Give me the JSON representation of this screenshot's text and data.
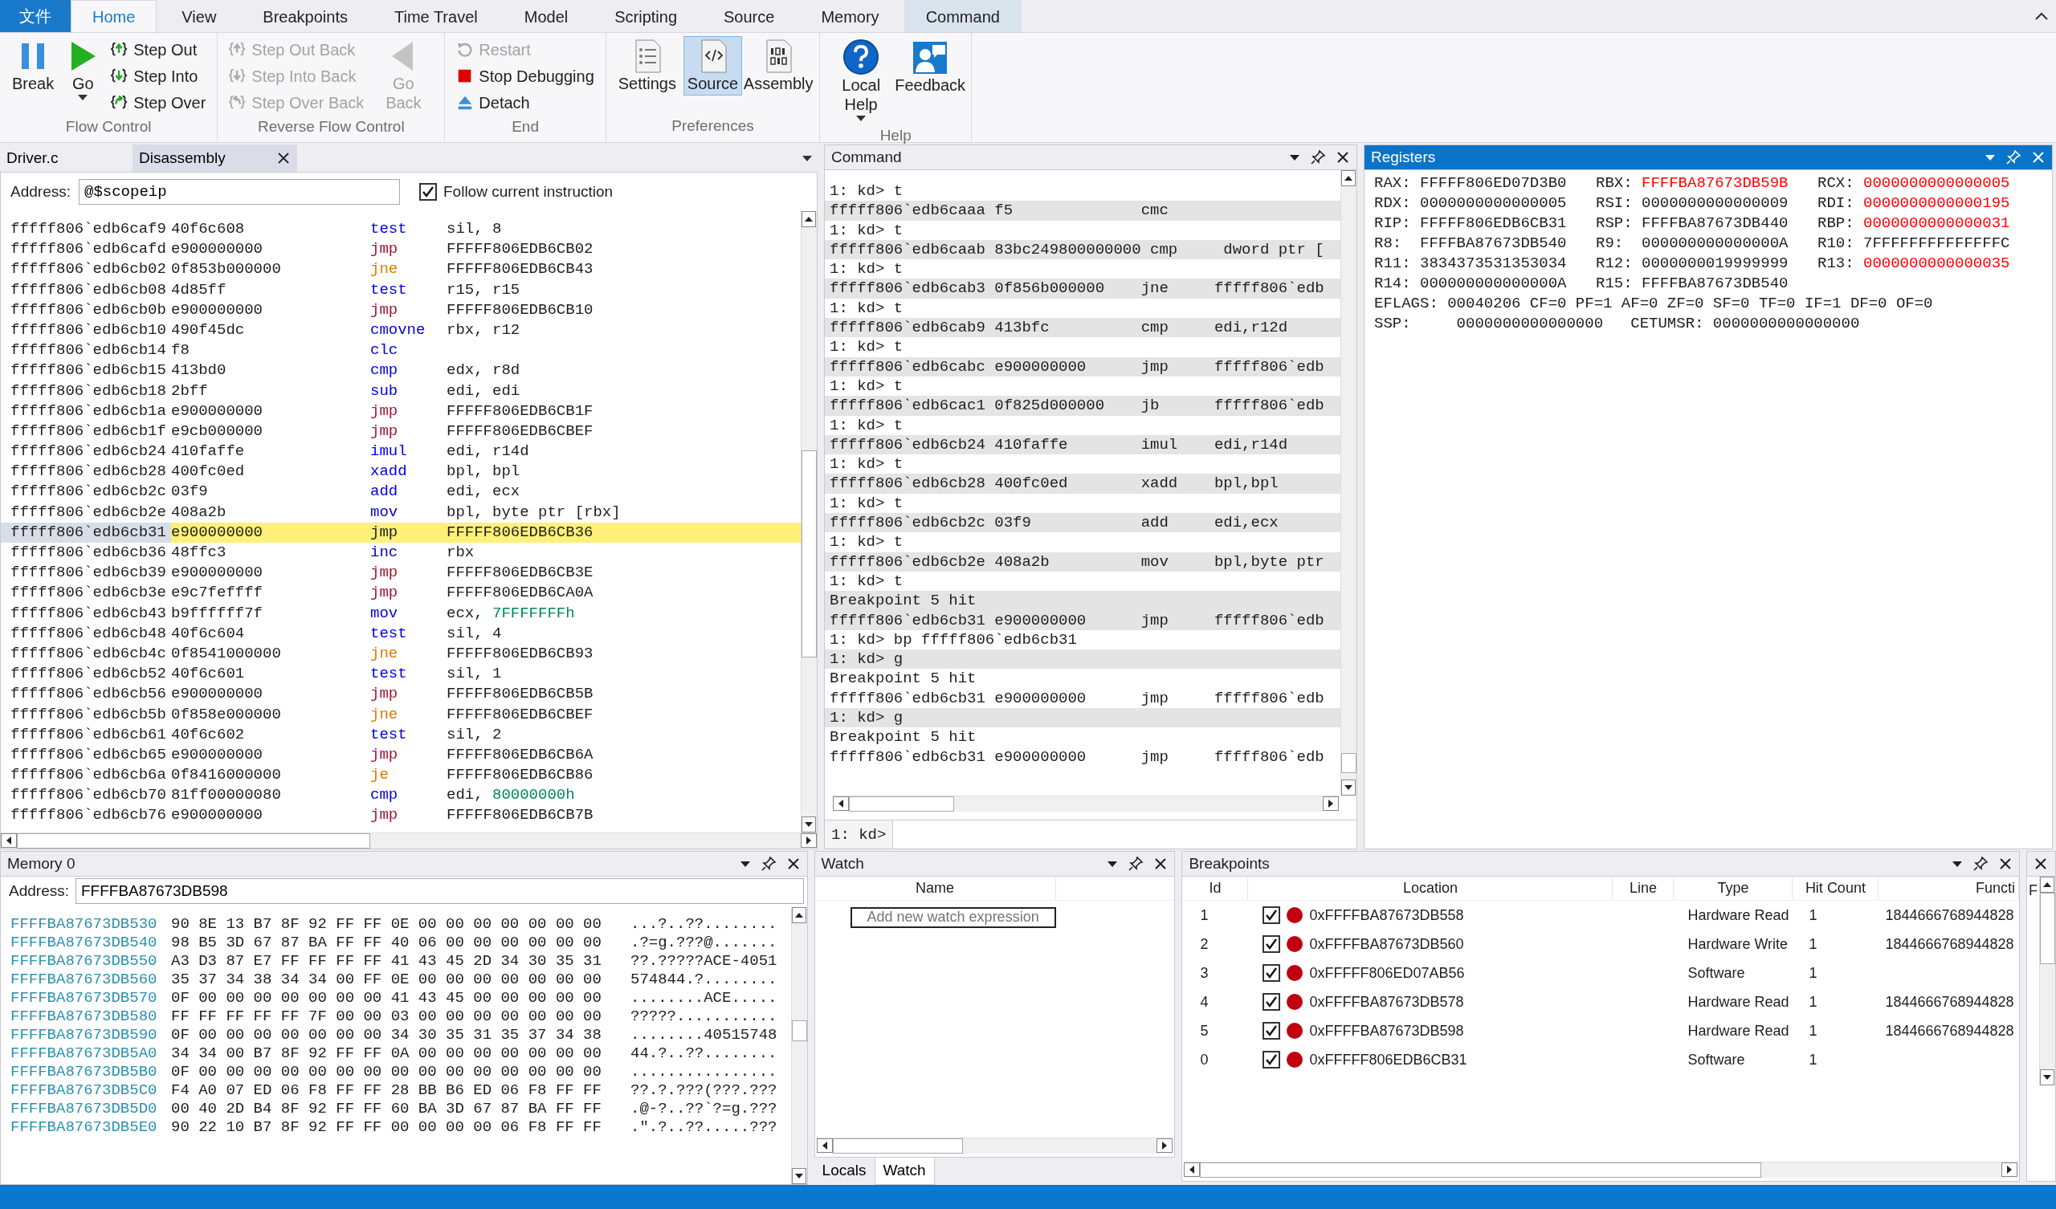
{
  "ribbon": {
    "file_tab": "文件",
    "tabs": [
      {
        "label": "Home",
        "selected": true,
        "highlighted": false
      },
      {
        "label": "View",
        "selected": false,
        "highlighted": false
      },
      {
        "label": "Breakpoints",
        "selected": false,
        "highlighted": false
      },
      {
        "label": "Time Travel",
        "selected": false,
        "highlighted": false
      },
      {
        "label": "Model",
        "selected": false,
        "highlighted": false
      },
      {
        "label": "Scripting",
        "selected": false,
        "highlighted": false
      },
      {
        "label": "Source",
        "selected": false,
        "highlighted": false
      },
      {
        "label": "Memory",
        "selected": false,
        "highlighted": false
      },
      {
        "label": "Command",
        "selected": false,
        "highlighted": true
      }
    ],
    "groups": [
      {
        "label": "Flow Control",
        "items": [
          {
            "label": "Break",
            "kind": "large",
            "disabled": false,
            "selected": false,
            "dropdown": false
          },
          {
            "label": "Go",
            "kind": "large",
            "disabled": false,
            "selected": false,
            "dropdown": true
          },
          {
            "label": "Step Out",
            "kind": "small",
            "disabled": false
          },
          {
            "label": "Step Into",
            "kind": "small",
            "disabled": false
          },
          {
            "label": "Step Over",
            "kind": "small",
            "disabled": false
          }
        ]
      },
      {
        "label": "Reverse Flow Control",
        "items": [
          {
            "label": "Step Out Back",
            "kind": "small",
            "disabled": true
          },
          {
            "label": "Step Into Back",
            "kind": "small",
            "disabled": true
          },
          {
            "label": "Step Over Back",
            "kind": "small",
            "disabled": true
          },
          {
            "label": "Go Back",
            "kind": "large",
            "disabled": true,
            "selected": false,
            "dropdown": false
          }
        ]
      },
      {
        "label": "End",
        "items": [
          {
            "label": "Restart",
            "kind": "small",
            "disabled": true
          },
          {
            "label": "Stop Debugging",
            "kind": "small",
            "disabled": false
          },
          {
            "label": "Detach",
            "kind": "small",
            "disabled": false
          }
        ]
      },
      {
        "label": "Preferences",
        "items": [
          {
            "label": "Settings",
            "kind": "large",
            "disabled": false,
            "selected": false,
            "dropdown": false
          },
          {
            "label": "Source",
            "kind": "large",
            "disabled": false,
            "selected": true,
            "dropdown": false
          },
          {
            "label": "Assembly",
            "kind": "large",
            "disabled": false,
            "selected": false,
            "dropdown": false
          }
        ]
      },
      {
        "label": "Help",
        "items": [
          {
            "label": "Local Help",
            "kind": "large",
            "disabled": false,
            "selected": false,
            "dropdown": true
          },
          {
            "label": "Feedback",
            "kind": "large",
            "disabled": false,
            "selected": false,
            "dropdown": false
          }
        ]
      }
    ]
  },
  "disassembly_pane": {
    "tabs": [
      {
        "label": "Driver.c",
        "selected": false
      },
      {
        "label": "Disassembly",
        "selected": true
      }
    ],
    "address_label": "Address:",
    "address": "@$scopeip",
    "follow": {
      "label": "Follow current instruction",
      "checked": true
    },
    "rows": [
      {
        "address": "fffff806`edb6caf9",
        "bytes": "40f6c608",
        "mnemonic": "test",
        "operands": "sil, 8",
        "color": "#0000e0",
        "current": false
      },
      {
        "address": "fffff806`edb6cafd",
        "bytes": "e900000000",
        "mnemonic": "jmp",
        "operands": "FFFFF806EDB6CB02",
        "color": "#a01530",
        "current": false
      },
      {
        "address": "fffff806`edb6cb02",
        "bytes": "0f853b000000",
        "mnemonic": "jne",
        "operands": "FFFFF806EDB6CB43",
        "color": "#e07800",
        "current": false
      },
      {
        "address": "fffff806`edb6cb08",
        "bytes": "4d85ff",
        "mnemonic": "test",
        "operands": "r15, r15",
        "color": "#0000e0",
        "current": false
      },
      {
        "address": "fffff806`edb6cb0b",
        "bytes": "e900000000",
        "mnemonic": "jmp",
        "operands": "FFFFF806EDB6CB10",
        "color": "#a01530",
        "current": false
      },
      {
        "address": "fffff806`edb6cb10",
        "bytes": "490f45dc",
        "mnemonic": "cmovne",
        "operands": "rbx, r12",
        "color": "#0000e0",
        "current": false
      },
      {
        "address": "fffff806`edb6cb14",
        "bytes": "f8",
        "mnemonic": "clc",
        "color": "#0000e0",
        "current": false
      },
      {
        "address": "fffff806`edb6cb15",
        "bytes": "413bd0",
        "mnemonic": "cmp",
        "operands": "edx, r8d",
        "color": "#0000e0",
        "current": false
      },
      {
        "address": "fffff806`edb6cb18",
        "bytes": "2bff",
        "mnemonic": "sub",
        "operands": "edi, edi",
        "color": "#0000e0",
        "current": false
      },
      {
        "address": "fffff806`edb6cb1a",
        "bytes": "e900000000",
        "mnemonic": "jmp",
        "operands": "FFFFF806EDB6CB1F",
        "color": "#a01530",
        "current": false
      },
      {
        "address": "fffff806`edb6cb1f",
        "bytes": "e9cb000000",
        "mnemonic": "jmp",
        "operands": "FFFFF806EDB6CBEF",
        "color": "#a01530",
        "current": false
      },
      {
        "address": "fffff806`edb6cb24",
        "bytes": "410faffe",
        "mnemonic": "imul",
        "operands": "edi, r14d",
        "color": "#0000e0",
        "current": false
      },
      {
        "address": "fffff806`edb6cb28",
        "bytes": "400fc0ed",
        "mnemonic": "xadd",
        "operands": "bpl, bpl",
        "color": "#0000e0",
        "current": false
      },
      {
        "address": "fffff806`edb6cb2c",
        "bytes": "03f9",
        "mnemonic": "add",
        "operands": "edi, ecx",
        "color": "#0000e0",
        "current": false
      },
      {
        "address": "fffff806`edb6cb2e",
        "bytes": "408a2b",
        "mnemonic": "mov",
        "operands": "bpl, byte ptr [rbx]",
        "color": "#0000e0",
        "current": false
      },
      {
        "address": "fffff806`edb6cb31",
        "bytes": "e900000000",
        "mnemonic": "jmp",
        "operands": "FFFFF806EDB6CB36",
        "current": true
      },
      {
        "address": "fffff806`edb6cb36",
        "bytes": "48ffc3",
        "mnemonic": "inc",
        "operands": "rbx",
        "color": "#0000e0",
        "current": false
      },
      {
        "address": "fffff806`edb6cb39",
        "bytes": "e900000000",
        "mnemonic": "jmp",
        "operands": "FFFFF806EDB6CB3E",
        "color": "#a01530",
        "current": false
      },
      {
        "address": "fffff806`edb6cb3e",
        "bytes": "e9c7feffff",
        "mnemonic": "jmp",
        "operands": "FFFFF806EDB6CA0A",
        "color": "#a01530",
        "current": false
      },
      {
        "address": "fffff806`edb6cb43",
        "bytes": "b9ffffff7f",
        "mnemonic": "mov",
        "operands": "ecx,",
        "immediate": "7FFFFFFFh",
        "color": "#0000e0",
        "current": false
      },
      {
        "address": "fffff806`edb6cb48",
        "bytes": "40f6c604",
        "mnemonic": "test",
        "operands": "sil, 4",
        "color": "#0000e0",
        "current": false
      },
      {
        "address": "fffff806`edb6cb4c",
        "bytes": "0f8541000000",
        "mnemonic": "jne",
        "operands": "FFFFF806EDB6CB93",
        "color": "#e07800",
        "current": false
      },
      {
        "address": "fffff806`edb6cb52",
        "bytes": "40f6c601",
        "mnemonic": "test",
        "operands": "sil, 1",
        "color": "#0000e0",
        "current": false
      },
      {
        "address": "fffff806`edb6cb56",
        "bytes": "e900000000",
        "mnemonic": "jmp",
        "operands": "FFFFF806EDB6CB5B",
        "color": "#a01530",
        "current": false
      },
      {
        "address": "fffff806`edb6cb5b",
        "bytes": "0f858e000000",
        "mnemonic": "jne",
        "operands": "FFFFF806EDB6CBEF",
        "color": "#e07800",
        "current": false
      },
      {
        "address": "fffff806`edb6cb61",
        "bytes": "40f6c602",
        "mnemonic": "test",
        "operands": "sil, 2",
        "color": "#0000e0",
        "current": false
      },
      {
        "address": "fffff806`edb6cb65",
        "bytes": "e900000000",
        "mnemonic": "jmp",
        "operands": "FFFFF806EDB6CB6A",
        "color": "#a01530",
        "current": false
      },
      {
        "address": "fffff806`edb6cb6a",
        "bytes": "0f8416000000",
        "mnemonic": "je",
        "operands": "FFFFF806EDB6CB86",
        "color": "#e07800",
        "current": false
      },
      {
        "address": "fffff806`edb6cb70",
        "bytes": "81ff00000080",
        "mnemonic": "cmp",
        "operands": "edi,",
        "immediate": "80000000h",
        "color": "#0000e0",
        "current": false
      },
      {
        "address": "fffff806`edb6cb76",
        "bytes": "e900000000",
        "mnemonic": "jmp",
        "operands": "FFFFF806EDB6CB7B",
        "color": "#a01530",
        "current": false
      }
    ]
  },
  "command_pane": {
    "title": "Command",
    "active": false,
    "prompt": "1: kd>",
    "lines": [
      {
        "text": "1: kd> t",
        "shaded": false
      },
      {
        "text": "fffff806`edb6caaa f5              cmc",
        "shaded": true
      },
      {
        "text": "1: kd> t",
        "shaded": false
      },
      {
        "text": "fffff806`edb6caab 83bc249800000000 cmp     dword ptr [",
        "shaded": true
      },
      {
        "text": "1: kd> t",
        "shaded": false
      },
      {
        "text": "fffff806`edb6cab3 0f856b000000    jne     fffff806`edb",
        "shaded": true
      },
      {
        "text": "1: kd> t",
        "shaded": false
      },
      {
        "text": "fffff806`edb6cab9 413bfc          cmp     edi,r12d",
        "shaded": true
      },
      {
        "text": "1: kd> t",
        "shaded": false
      },
      {
        "text": "fffff806`edb6cabc e900000000      jmp     fffff806`edb",
        "shaded": true
      },
      {
        "text": "1: kd> t",
        "shaded": false
      },
      {
        "text": "fffff806`edb6cac1 0f825d000000    jb      fffff806`edb",
        "shaded": true
      },
      {
        "text": "1: kd> t",
        "shaded": false
      },
      {
        "text": "fffff806`edb6cb24 410faffe        imul    edi,r14d",
        "shaded": true
      },
      {
        "text": "1: kd> t",
        "shaded": false
      },
      {
        "text": "fffff806`edb6cb28 400fc0ed        xadd    bpl,bpl",
        "shaded": true
      },
      {
        "text": "1: kd> t",
        "shaded": false
      },
      {
        "text": "fffff806`edb6cb2c 03f9            add     edi,ecx",
        "shaded": true
      },
      {
        "text": "1: kd> t",
        "shaded": false
      },
      {
        "text": "fffff806`edb6cb2e 408a2b          mov     bpl,byte ptr",
        "shaded": true
      },
      {
        "text": "1: kd> t",
        "shaded": false
      },
      {
        "text": "Breakpoint 5 hit",
        "shaded": true
      },
      {
        "text": "fffff806`edb6cb31 e900000000      jmp     fffff806`edb",
        "shaded": true
      },
      {
        "text": "1: kd> bp fffff806`edb6cb31",
        "shaded": false
      },
      {
        "text": "1: kd> g",
        "shaded": true
      },
      {
        "text": "Breakpoint 5 hit",
        "shaded": false
      },
      {
        "text": "fffff806`edb6cb31 e900000000      jmp     fffff806`edb",
        "shaded": false
      },
      {
        "text": "1: kd> g",
        "shaded": true
      },
      {
        "text": "Breakpoint 5 hit",
        "shaded": false
      },
      {
        "text": "fffff806`edb6cb31 e900000000      jmp     fffff806`edb",
        "shaded": false
      }
    ]
  },
  "registers_pane": {
    "title": "Registers",
    "active": true,
    "registers": [
      {
        "name": "RAX:",
        "value": "FFFFF806ED07D3B0",
        "changed": false
      },
      {
        "name": "RBX:",
        "value": "FFFFBA87673DB59B",
        "changed": true
      },
      {
        "name": "RCX:",
        "value": "0000000000000005",
        "changed": true
      },
      {
        "name": "RDX:",
        "value": "0000000000000005",
        "changed": false
      },
      {
        "name": "RSI:",
        "value": "0000000000000009",
        "changed": false
      },
      {
        "name": "RDI:",
        "value": "0000000000000195",
        "changed": true
      },
      {
        "name": "RIP:",
        "value": "FFFFF806EDB6CB31",
        "changed": false
      },
      {
        "name": "RSP:",
        "value": "FFFFBA87673DB440",
        "changed": false
      },
      {
        "name": "RBP:",
        "value": "0000000000000031",
        "changed": true
      },
      {
        "name": "R8:",
        "value": "FFFFBA87673DB540",
        "changed": false
      },
      {
        "name": "R9:",
        "value": "000000000000000A",
        "changed": false
      },
      {
        "name": "R10:",
        "value": "7FFFFFFFFFFFFFFC",
        "changed": false
      },
      {
        "name": "R11:",
        "value": "3834373531353034",
        "changed": false
      },
      {
        "name": "R12:",
        "value": "0000000019999999",
        "changed": false
      },
      {
        "name": "R13:",
        "value": "0000000000000035",
        "changed": true
      },
      {
        "name": "R14:",
        "value": "000000000000000A",
        "changed": false
      },
      {
        "name": "R15:",
        "value": "FFFFBA87673DB540",
        "changed": false
      }
    ],
    "status_lines": [
      "EFLAGS: 00040206 CF=0 PF=1 AF=0 ZF=0 SF=0 TF=0 IF=1 DF=0 OF=0",
      "SSP:     0000000000000000   CETUMSR: 0000000000000000"
    ]
  },
  "memory_pane": {
    "title": "Memory 0",
    "active": false,
    "address_label": "Address:",
    "address": "FFFFBA87673DB598",
    "rows": [
      {
        "address": "FFFFBA87673DB530",
        "bytes": "90 8E 13 B7 8F 92 FF FF 0E 00 00 00 00 00 00 00",
        "ascii": "...?..??........"
      },
      {
        "address": "FFFFBA87673DB540",
        "bytes": "98 B5 3D 67 87 BA FF FF 40 06 00 00 00 00 00 00",
        "ascii": ".?=g.???@......."
      },
      {
        "address": "FFFFBA87673DB550",
        "bytes": "A3 D3 87 E7 FF FF FF FF 41 43 45 2D 34 30 35 31",
        "ascii": "??.?????ACE-4051"
      },
      {
        "address": "FFFFBA87673DB560",
        "bytes": "35 37 34 38 34 34 00 FF 0E 00 00 00 00 00 00 00",
        "ascii": "574844.?........"
      },
      {
        "address": "FFFFBA87673DB570",
        "bytes": "0F 00 00 00 00 00 00 00 41 43 45 00 00 00 00 00",
        "ascii": "........ACE....."
      },
      {
        "address": "FFFFBA87673DB580",
        "bytes": "FF FF FF FF FF 7F 00 00 03 00 00 00 00 00 00 00",
        "ascii": "?????..........."
      },
      {
        "address": "FFFFBA87673DB590",
        "bytes": "0F 00 00 00 00 00 00 00 34 30 35 31 35 37 34 38",
        "ascii": "........40515748"
      },
      {
        "address": "FFFFBA87673DB5A0",
        "bytes": "34 34 00 B7 8F 92 FF FF 0A 00 00 00 00 00 00 00",
        "ascii": "44.?..??........"
      },
      {
        "address": "FFFFBA87673DB5B0",
        "bytes": "0F 00 00 00 00 00 00 00 00 00 00 00 00 00 00 00",
        "ascii": "................"
      },
      {
        "address": "FFFFBA87673DB5C0",
        "bytes": "F4 A0 07 ED 06 F8 FF FF 28 BB B6 ED 06 F8 FF FF",
        "ascii": "??.?.???(???.???"
      },
      {
        "address": "FFFFBA87673DB5D0",
        "bytes": "00 40 2D B4 8F 92 FF FF 60 BA 3D 67 87 BA FF FF",
        "ascii": ".@-?..??`?=g.???"
      },
      {
        "address": "FFFFBA87673DB5E0",
        "bytes": "90 22 10 B7 8F 92 FF FF 00 00 00 00 06 F8 FF FF",
        "ascii": ".\".?..??.....???"
      }
    ]
  },
  "watch_pane": {
    "title": "Watch",
    "active": false,
    "columns": [
      "Name"
    ],
    "new_entry": {
      "placeholder": "Add new watch expression"
    },
    "tabs": [
      {
        "label": "Locals",
        "selected": false
      },
      {
        "label": "Watch",
        "selected": true
      }
    ]
  },
  "breakpoints_pane": {
    "title": "Breakpoints",
    "active": false,
    "columns": [
      "Id",
      "Location",
      "Line",
      "Type",
      "Hit Count",
      "Functi"
    ],
    "rows": [
      {
        "id": "1",
        "enabled": true,
        "location": "0xFFFFBA87673DB558",
        "type": "Hardware Read",
        "hit_count": "1",
        "function": "1844666768944828"
      },
      {
        "id": "2",
        "enabled": true,
        "location": "0xFFFFBA87673DB560",
        "type": "Hardware Write",
        "hit_count": "1",
        "function": "1844666768944828"
      },
      {
        "id": "3",
        "enabled": true,
        "location": "0xFFFFF806ED07AB56",
        "type": "Software",
        "hit_count": "1"
      },
      {
        "id": "4",
        "enabled": true,
        "location": "0xFFFFBA87673DB578",
        "type": "Hardware Read",
        "hit_count": "1",
        "function": "1844666768944828"
      },
      {
        "id": "5",
        "enabled": true,
        "location": "0xFFFFBA87673DB598",
        "type": "Hardware Read",
        "hit_count": "1",
        "function": "1844666768944828"
      },
      {
        "id": "0",
        "enabled": true,
        "location": "0xFFFFF806EDB6CB31",
        "type": "Software",
        "hit_count": "1"
      }
    ]
  },
  "side_pane": {
    "column": "F"
  }
}
